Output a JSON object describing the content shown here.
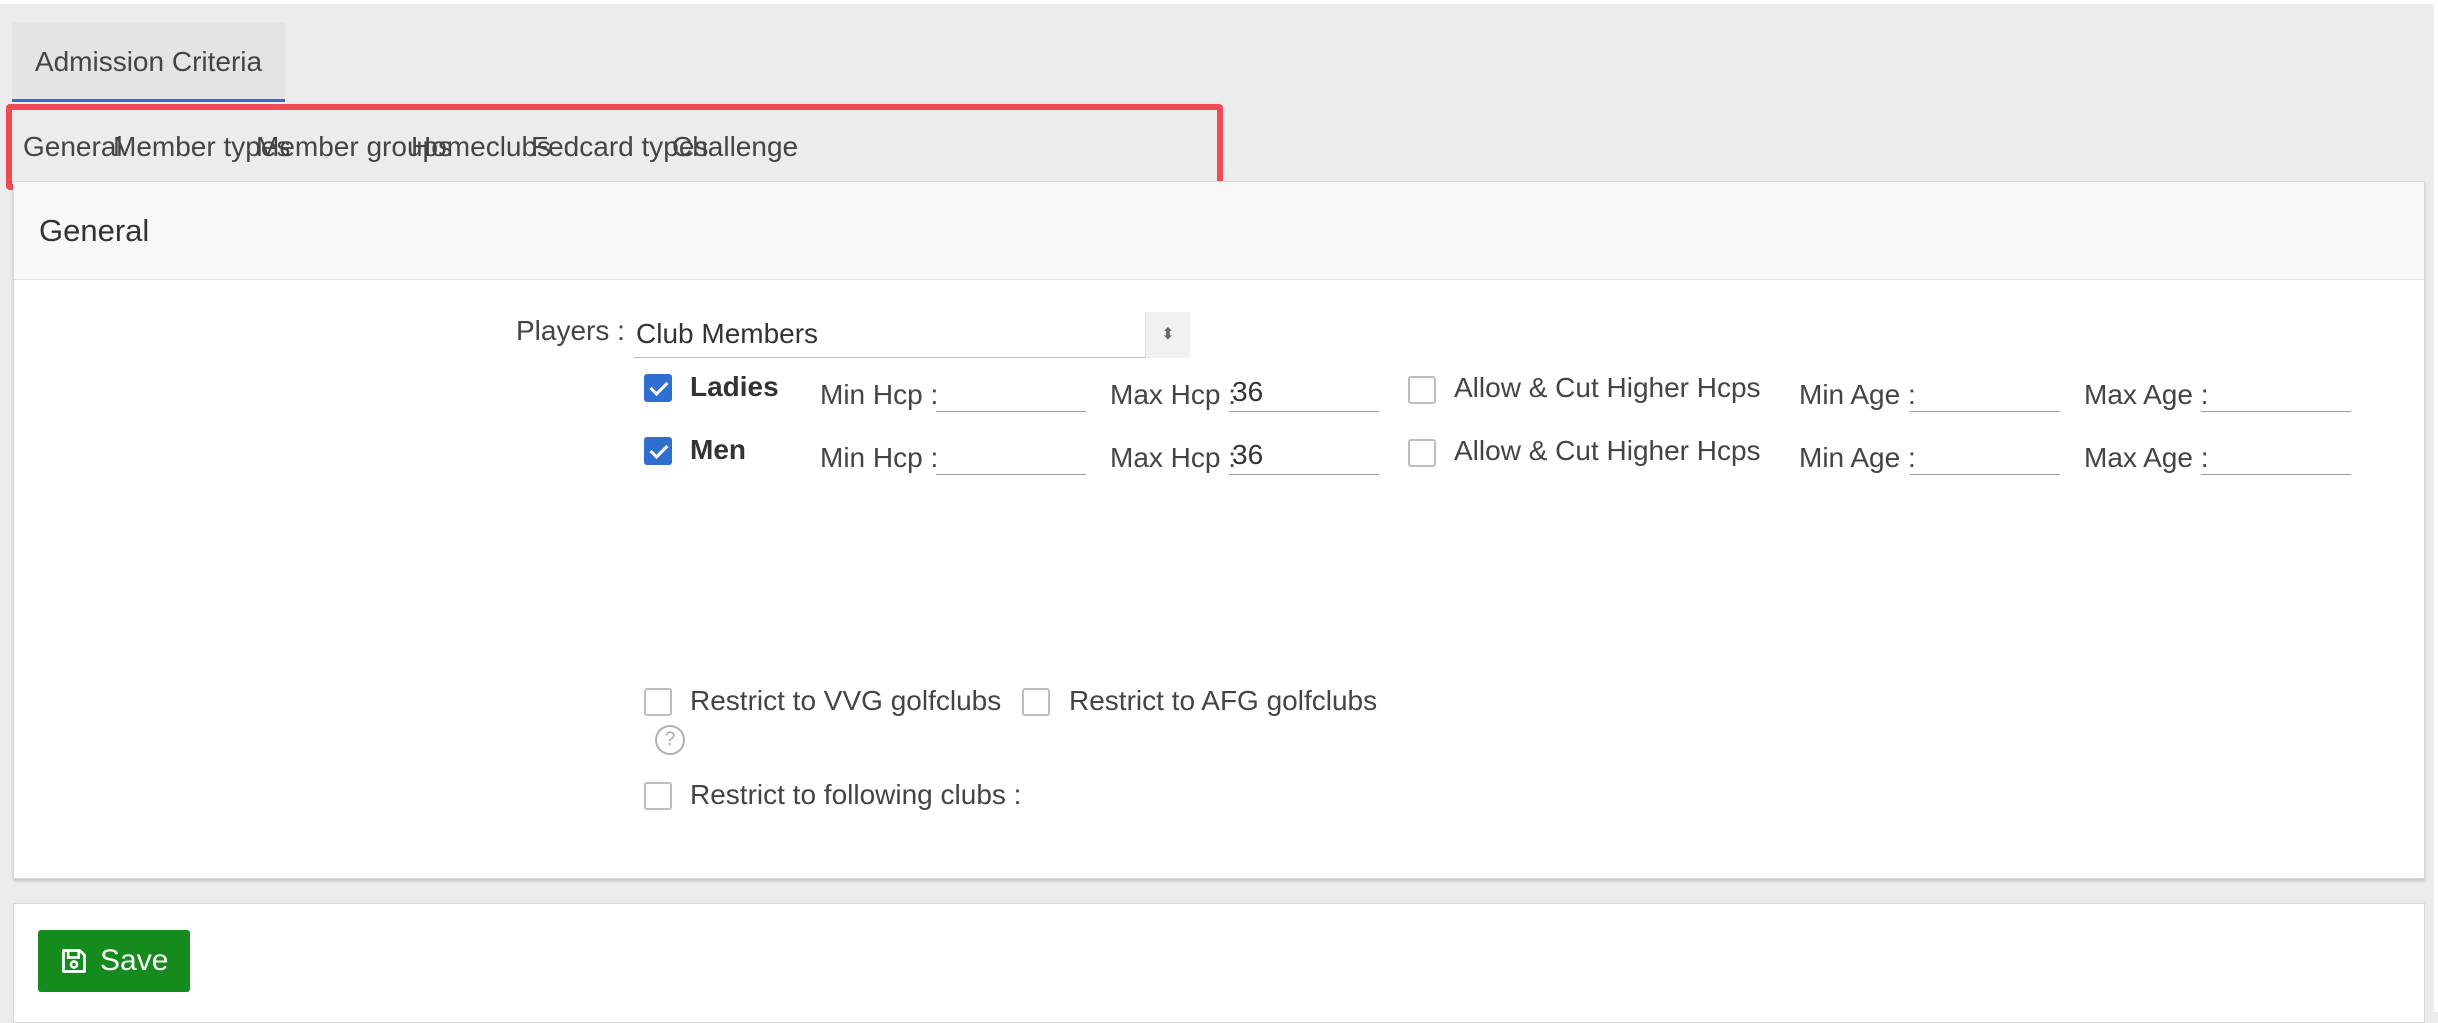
{
  "outer_tab": {
    "label": "Admission Criteria"
  },
  "subtabs": [
    "General",
    "Member types",
    "Member groups",
    "Homeclubs",
    "Fedcard types",
    "Challenge"
  ],
  "panel": {
    "title": "General"
  },
  "players": {
    "label": "Players :",
    "value": "Club Members"
  },
  "rows": [
    {
      "name": "Ladies",
      "checked": true,
      "min_hcp_label": "Min Hcp :",
      "min_hcp": "",
      "max_hcp_label": "Max Hcp :",
      "max_hcp": "36",
      "allow_label": "Allow & Cut Higher Hcps",
      "allow_checked": false,
      "min_age_label": "Min Age :",
      "min_age": "",
      "max_age_label": "Max Age :",
      "max_age": ""
    },
    {
      "name": "Men",
      "checked": true,
      "min_hcp_label": "Min Hcp :",
      "min_hcp": "",
      "max_hcp_label": "Max Hcp :",
      "max_hcp": "36",
      "allow_label": "Allow & Cut Higher Hcps",
      "allow_checked": false,
      "min_age_label": "Min Age :",
      "min_age": "",
      "max_age_label": "Max Age :",
      "max_age": ""
    }
  ],
  "restrict": {
    "vvg": "Restrict to VVG golfclubs",
    "afg": "Restrict to AFG golfclubs",
    "following": "Restrict to following clubs :",
    "help": "?"
  },
  "save": {
    "label": "Save"
  },
  "colors": {
    "accent": "#2f6fcf",
    "highlight_border": "#f04b55",
    "save_green": "#158a1d"
  }
}
